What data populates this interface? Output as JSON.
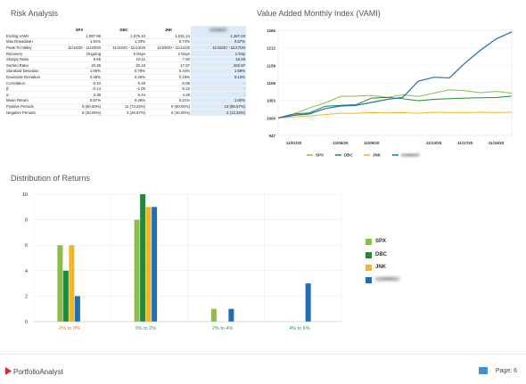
{
  "titles": {
    "risk": "Risk Analysis",
    "vami": "Value Added Monthly Index (VAMI)",
    "distribution": "Distribution of Returns"
  },
  "risk_table": {
    "headers": [
      "",
      "SPX",
      "DBC",
      "JNK",
      "U1949437"
    ],
    "rows": [
      [
        "Ending VAMI",
        "1,087.95",
        "1,075.10",
        "1,031.24",
        "1,267.04"
      ],
      [
        "Max Drawdown",
        "1.91%",
        "1.33%",
        "0.74%",
        "0.57%"
      ],
      [
        "Peak-To-Valley",
        "11/16/20 - 11/20/20",
        "11/10/20 - 11/13/20",
        "11/09/20 - 11/12/20",
        "11/16/20 - 11/17/20"
      ],
      [
        "Recovery",
        "Ongoing",
        "5 Days",
        "2 Days",
        "1 Day"
      ],
      [
        "Sharpe Ratio",
        "8.65",
        "10.11",
        "7.50",
        "16.28"
      ],
      [
        "Sortino Ratio",
        "20.35",
        "30.19",
        "17.87",
        "202.97"
      ],
      [
        "Standard Deviation",
        "1.06%",
        "0.78%",
        "0.44%",
        "1.59%"
      ],
      [
        "Downside Deviation",
        "0.45%",
        "0.26%",
        "0.19%",
        "0.13%"
      ],
      [
        "Correlation",
        "-0.10",
        "0.49",
        "-0.06",
        "-"
      ],
      [
        "β:",
        "-0.14",
        "-1.00",
        "-0.22",
        "-"
      ],
      [
        "α:",
        "4.38",
        "5.44",
        "4.29",
        "-"
      ],
      [
        "Mean Return",
        "0.57%",
        "0.49%",
        "0.21%",
        "1.60%"
      ],
      [
        "Positive Periods",
        "9 (60.00%)",
        "11 (73.33%)",
        "9 (60.00%)",
        "13 (86.67%)"
      ],
      [
        "Negative Periods",
        "6 (40.00%)",
        "4 (26.67%)",
        "6 (40.00%)",
        "2 (13.33%)"
      ]
    ]
  },
  "colors": {
    "spx": "#8cbd4a",
    "dbc": "#1e8a3c",
    "jnk": "#f2b52a",
    "acct": "#1f6fb5",
    "bin_neg": "#e07b2a",
    "bin_pos": "#2a9d4a"
  },
  "chart_data": [
    {
      "type": "line",
      "title": "Value Added Monthly Index (VAMI)",
      "x": [
        "10/30/20",
        "11/02/20",
        "11/03/20",
        "11/04/20",
        "11/05/20",
        "11/06/20",
        "11/09/20",
        "11/10/20",
        "11/11/20",
        "11/12/20",
        "11/13/20",
        "11/16/20",
        "11/17/20",
        "11/18/20",
        "11/19/20",
        "11/20/20"
      ],
      "xticks": [
        "11/01/20",
        "11/05/20",
        "11/09/20",
        "11/13/20",
        "11/17/20",
        "11/19/20"
      ],
      "ylim": [
        947,
        1265
      ],
      "yticks": [
        947,
        1000,
        1053,
        1106,
        1159,
        1212,
        1265
      ],
      "series": [
        {
          "name": "SPX",
          "values": [
            1000,
            1012,
            1030,
            1045,
            1065,
            1066,
            1068,
            1062,
            1070,
            1065,
            1075,
            1085,
            1082,
            1076,
            1080,
            1075
          ]
        },
        {
          "name": "DBC",
          "values": [
            1000,
            1012,
            1015,
            1035,
            1038,
            1040,
            1060,
            1062,
            1058,
            1052,
            1056,
            1058,
            1060,
            1061,
            1062,
            1066
          ]
        },
        {
          "name": "JNK",
          "values": [
            1000,
            1003,
            1006,
            1010,
            1014,
            1014,
            1016,
            1015,
            1016,
            1014,
            1017,
            1016,
            1016,
            1017,
            1016,
            1017
          ]
        },
        {
          "name": "U1949437",
          "values": [
            1000,
            1008,
            1012,
            1028,
            1036,
            1038,
            1047,
            1056,
            1062,
            1111,
            1123,
            1121,
            1166,
            1205,
            1239,
            1260
          ]
        }
      ],
      "legend": "bottom"
    },
    {
      "type": "bar",
      "title": "Distribution of Returns",
      "categories": [
        "-2% to 0%",
        "0% to 2%",
        "2% to 4%",
        "4% to 6%"
      ],
      "ylim": [
        0,
        10
      ],
      "yticks": [
        0,
        2,
        4,
        6,
        8,
        10
      ],
      "series": [
        {
          "name": "SPX",
          "values": [
            6,
            8,
            1,
            0
          ]
        },
        {
          "name": "DBC",
          "values": [
            4,
            10,
            0,
            0
          ]
        },
        {
          "name": "JNK",
          "values": [
            6,
            9,
            0,
            0
          ]
        },
        {
          "name": "U1949437",
          "values": [
            2,
            9,
            1,
            3
          ]
        }
      ],
      "legend": "right"
    }
  ],
  "footer": {
    "brand": "PortfolioAnalyst",
    "page": "Page: 6"
  }
}
